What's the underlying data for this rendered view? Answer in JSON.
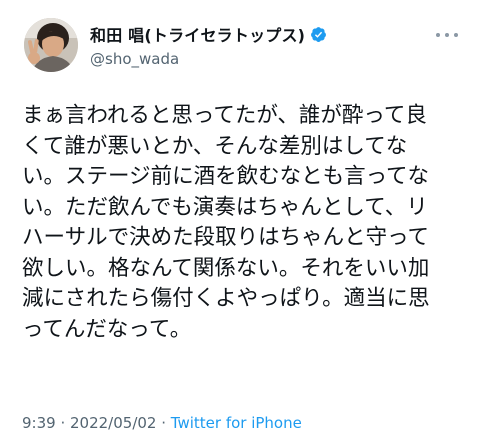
{
  "author": {
    "display_name": "和田 唱(トライセラトップス)",
    "handle": "@sho_wada",
    "verified": true
  },
  "tweet": {
    "lines": [
      "まぁ言われると思ってたが、誰が酔って良",
      "くて誰が悪いとか、そんな差別はしてな",
      "い。ステージ前に酒を飲むなとも言ってな",
      "い。ただ飲んでも演奏はちゃんとして、リ",
      "ハーサルで決めた段取りはちゃんと守って",
      "欲しい。格なんて関係ない。それをいい加",
      "減にされたら傷付くよやっぱり。適当に思",
      "ってんだなって。"
    ]
  },
  "meta": {
    "time": "9:39",
    "separator1": " · ",
    "date": "2022/05/02",
    "separator2": " · ",
    "source": "Twitter for iPhone"
  },
  "icons": {
    "avatar": "user-photo-avatar",
    "verified": "verified-badge-icon",
    "more": "more-options-icon"
  },
  "colors": {
    "text": "#0f1419",
    "secondary": "#536471",
    "link": "#1d9bf0",
    "verified": "#1d9bf0"
  }
}
